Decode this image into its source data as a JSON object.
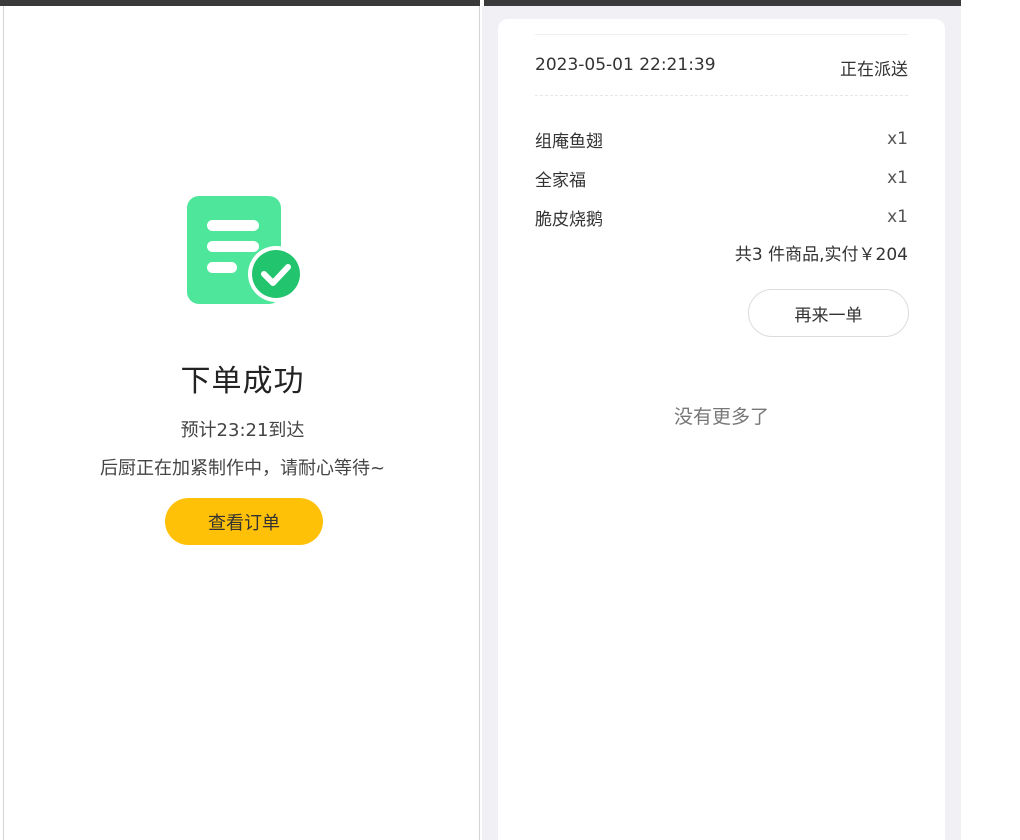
{
  "left": {
    "title": "下单成功",
    "eta": "预计23:21到达",
    "message": "后厨正在加紧制作中，请耐心等待~",
    "view_order_label": "查看订单"
  },
  "right": {
    "order_time": "2023-05-01 22:21:39",
    "order_status": "正在派送",
    "items": [
      {
        "name": "组庵鱼翅",
        "qty": "x1"
      },
      {
        "name": "全家福",
        "qty": "x1"
      },
      {
        "name": "脆皮烧鹅",
        "qty": "x1"
      }
    ],
    "summary": "共3 件商品,实付￥204",
    "reorder_label": "再来一单",
    "no_more": "没有更多了"
  },
  "colors": {
    "accent_button": "#ffc107",
    "icon_green": "#4ee69b",
    "check_green": "#22c46d",
    "page_bg": "#f1f1f5"
  },
  "icons": {
    "success": "document-check-icon"
  }
}
